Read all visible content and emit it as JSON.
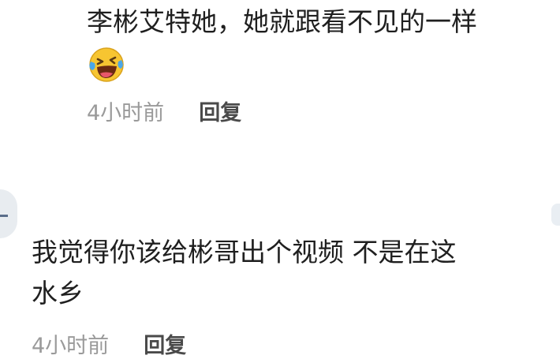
{
  "reply_comment": {
    "text": "李彬艾特她，她就跟看不见的一样",
    "emoji": "laughing-crying-emoji",
    "time": "4小时前",
    "reply_label": "回复"
  },
  "comment": {
    "username": "",
    "text_line1": "我觉得你该给彬哥出个视频 不是在这",
    "text_line2": "水乡",
    "time": "4小时前",
    "reply_label": "回复"
  }
}
